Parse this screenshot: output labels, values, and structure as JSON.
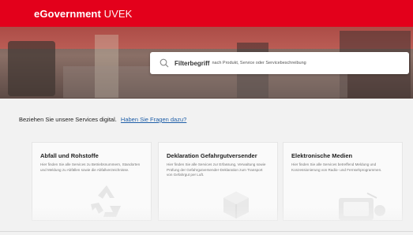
{
  "header": {
    "brand_bold": "eGovernment",
    "brand_light": "UVEK",
    "brand_color": "#e3001b"
  },
  "search": {
    "label": "Filterbegriff",
    "hint": "nach Produkt, Service oder Servicebeschreibung",
    "icon": "search-icon"
  },
  "intro": {
    "text": "Beziehen Sie unsere Services digital.",
    "link": "Haben Sie Fragen dazu?"
  },
  "cards": [
    {
      "title": "Abfall und Rohstoffe",
      "description": "Hier finden Sie alle Services zu Betriebsnummern, Standorten und Meldung zu Abfällen sowie die Abfallverzeichnisse.",
      "icon": "recycle-icon"
    },
    {
      "title": "Deklaration Gefahrgutversender",
      "description": "Hier finden Sie alle Services zur Erfassung, Verwaltung sowie Prüfung der Gefahrgutversender-Deklaration zum Transport von Gefahrgut per Luft.",
      "icon": "package-icon"
    },
    {
      "title": "Elektronische Medien",
      "description": "Hier finden Sie alle Services betreffend Meldung und Konzessionierung von Radio- und Fernsehprogrammen.",
      "icon": "radio-icon"
    }
  ]
}
